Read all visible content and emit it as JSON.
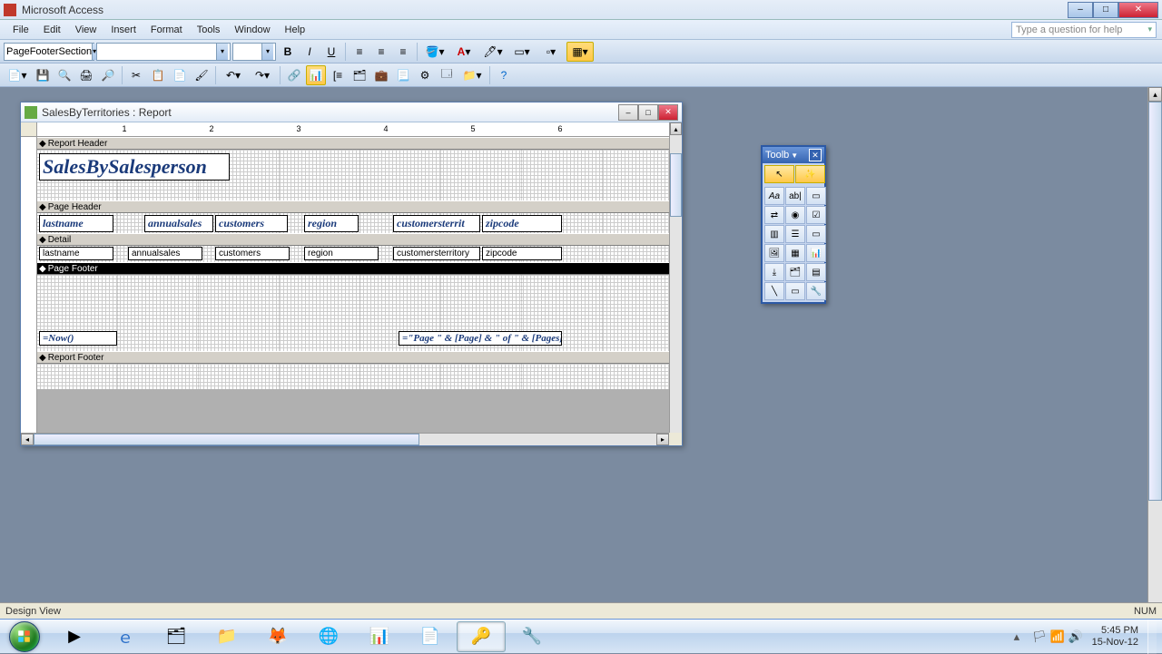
{
  "app": {
    "title": "Microsoft Access"
  },
  "menu": {
    "items": [
      "File",
      "Edit",
      "View",
      "Insert",
      "Format",
      "Tools",
      "Window",
      "Help"
    ],
    "helpPlaceholder": "Type a question for help"
  },
  "formatting": {
    "objectSelector": "PageFooterSection",
    "fontName": "",
    "fontSize": ""
  },
  "reportWindow": {
    "title": "SalesByTerritories : Report",
    "sections": {
      "reportHeader": {
        "label": "Report Header",
        "titleControl": "SalesBySalesperson"
      },
      "pageHeader": {
        "label": "Page Header",
        "columns": [
          "lastname",
          "annualsales",
          "customers",
          "region",
          "customersterrit",
          "zipcode"
        ]
      },
      "detail": {
        "label": "Detail",
        "fields": [
          "lastname",
          "annualsales",
          "customers",
          "region",
          "customersterritory",
          "zipcode"
        ]
      },
      "pageFooter": {
        "label": "Page Footer",
        "left": "=Now()",
        "right": "=\"Page \" & [Page] & \" of \" & [Pages]"
      },
      "reportFooter": {
        "label": "Report Footer"
      }
    }
  },
  "toolbox": {
    "title": "Toolb"
  },
  "status": {
    "left": "Design View",
    "right": "NUM"
  },
  "taskbar": {
    "clock": {
      "time": "5:45 PM",
      "date": "15-Nov-12"
    }
  }
}
